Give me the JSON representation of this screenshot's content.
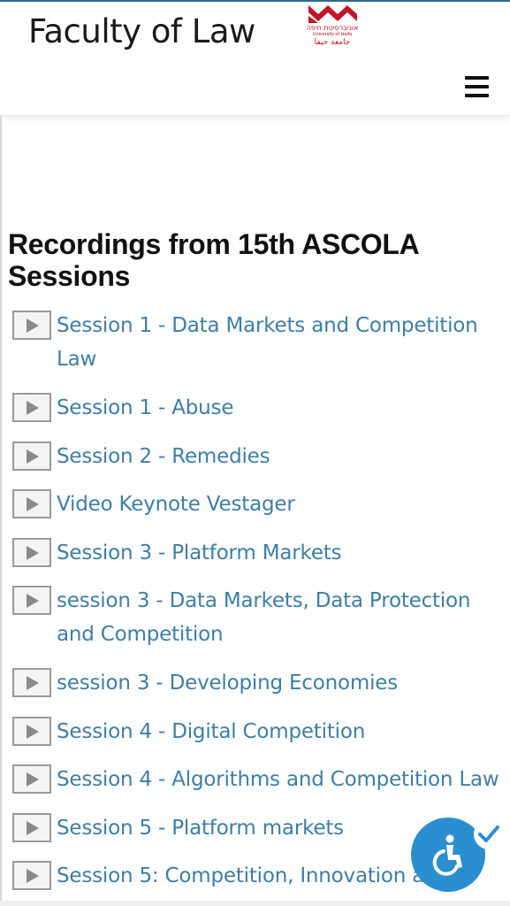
{
  "header": {
    "site_title": "Faculty of Law",
    "logo": {
      "hebrew": "אוניברסיטת חיפה",
      "english": "University of Haifa",
      "arabic": "جامعة حيفا"
    },
    "menu_icon": "hamburger-menu-icon"
  },
  "main": {
    "heading": "Recordings from 15th ASCOLA Sessions",
    "sessions": [
      {
        "label": "Session 1 - Data Markets and Competition Law",
        "icon": "play-icon"
      },
      {
        "label": "Session 1 - Abuse",
        "icon": "play-icon"
      },
      {
        "label": "Session 2 - Remedies",
        "icon": "play-icon"
      },
      {
        "label": "Video Keynote Vestager",
        "icon": "play-icon"
      },
      {
        "label": "Session 3 - Platform Markets",
        "icon": "play-icon"
      },
      {
        "label": "session 3 - Data Markets, Data Protection and Competition",
        "icon": "play-icon"
      },
      {
        "label": "session 3 - Developing Economies",
        "icon": "play-icon"
      },
      {
        "label": "Session 4 - Digital Competition",
        "icon": "play-icon"
      },
      {
        "label": "Session 4 - Algorithms and Competition Law",
        "icon": "play-icon"
      },
      {
        "label": "Session 5 - Platform markets",
        "icon": "play-icon"
      },
      {
        "label": "Session 5: Competition, Innovation a",
        "icon": "play-icon"
      }
    ]
  },
  "accessibility": {
    "icon": "wheelchair-accessibility-icon",
    "badge_icon": "checkmark-icon"
  },
  "colors": {
    "link": "#3d7ea6",
    "heading": "#111111",
    "accent_blue": "#2b8ed1",
    "brand_red": "#c2152a"
  }
}
